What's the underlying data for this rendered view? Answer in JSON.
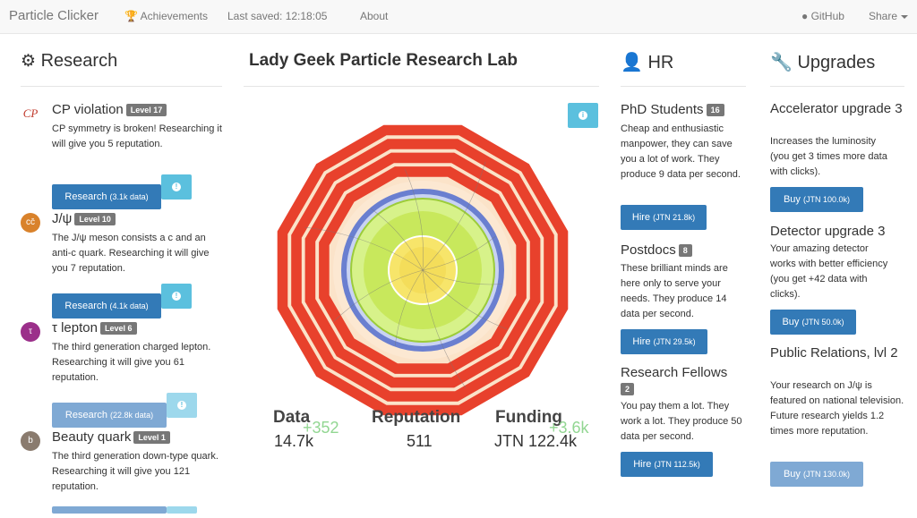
{
  "navbar": {
    "brand": "Particle Clicker",
    "achievements": "Achievements",
    "last_saved": "Last saved: 12:18:05",
    "about": "About",
    "github": "GitHub",
    "share": "Share"
  },
  "research": {
    "title": "Research",
    "items": [
      {
        "name": "CP violation",
        "level": "Level 17",
        "icon_text": "CP",
        "desc": "CP symmetry is broken! Researching it will give you 5 reputation.",
        "button": "Research",
        "cost": "(3.1k data)"
      },
      {
        "name": "J/ψ",
        "level": "Level 10",
        "icon_text": "cc̄",
        "desc": "The J/ψ meson consists a c and an anti-c quark. Researching it will give you 7 reputation.",
        "button": "Research",
        "cost": "(4.1k data)"
      },
      {
        "name": "τ lepton",
        "level": "Level 6",
        "icon_text": "τ",
        "desc": "The third generation charged lepton. Researching it will give you 61 reputation.",
        "button": "Research",
        "cost": "(22.8k data)"
      },
      {
        "name": "Beauty quark",
        "level": "Level 1",
        "icon_text": "b",
        "desc": "The third generation down-type quark. Researching it will give you 121 reputation."
      }
    ]
  },
  "lab": {
    "title": "Lady Geek Particle Research Lab",
    "stats": [
      {
        "label": "Data",
        "value": "14.7k",
        "inc": "+352"
      },
      {
        "label": "Reputation",
        "value": "511"
      },
      {
        "label": "Funding",
        "value": "JTN 122.4k",
        "inc": "+3.6k"
      }
    ]
  },
  "hr": {
    "title": "HR",
    "items": [
      {
        "name": "PhD Students",
        "count": "16",
        "desc": "Cheap and enthusiastic manpower, they can save you a lot of work. They produce 9 data per second.",
        "button": "Hire",
        "cost": "(JTN 21.8k)"
      },
      {
        "name": "Postdocs",
        "count": "8",
        "desc": "These brilliant minds are here only to serve your needs. They produce 14 data per second.",
        "button": "Hire",
        "cost": "(JTN 29.5k)"
      },
      {
        "name": "Research Fellows",
        "count": "2",
        "desc": "You pay them a lot. They work a lot. They produce 50 data per second.",
        "button": "Hire",
        "cost": "(JTN 112.5k)"
      }
    ]
  },
  "upgrades": {
    "title": "Upgrades",
    "items": [
      {
        "name": "Accelerator upgrade 3",
        "desc": "Increases the luminosity (you get 3 times more data with clicks).",
        "button": "Buy",
        "cost": "(JTN 100.0k)"
      },
      {
        "name": "Detector upgrade 3",
        "desc": "Your amazing detector works with better efficiency (you get +42 data with clicks).",
        "button": "Buy",
        "cost": "(JTN 50.0k)"
      },
      {
        "name": "Public Relations, lvl 2",
        "desc": "Your research on J/ψ is featured on national television. Future research yields 1.2 times more reputation.",
        "button": "Buy",
        "cost": "(JTN 130.0k)"
      }
    ]
  },
  "colors": {
    "primary": "#337ab7",
    "info": "#5bc0de",
    "detector_red": "#e8412c",
    "increment_green": "#7fd07f"
  }
}
